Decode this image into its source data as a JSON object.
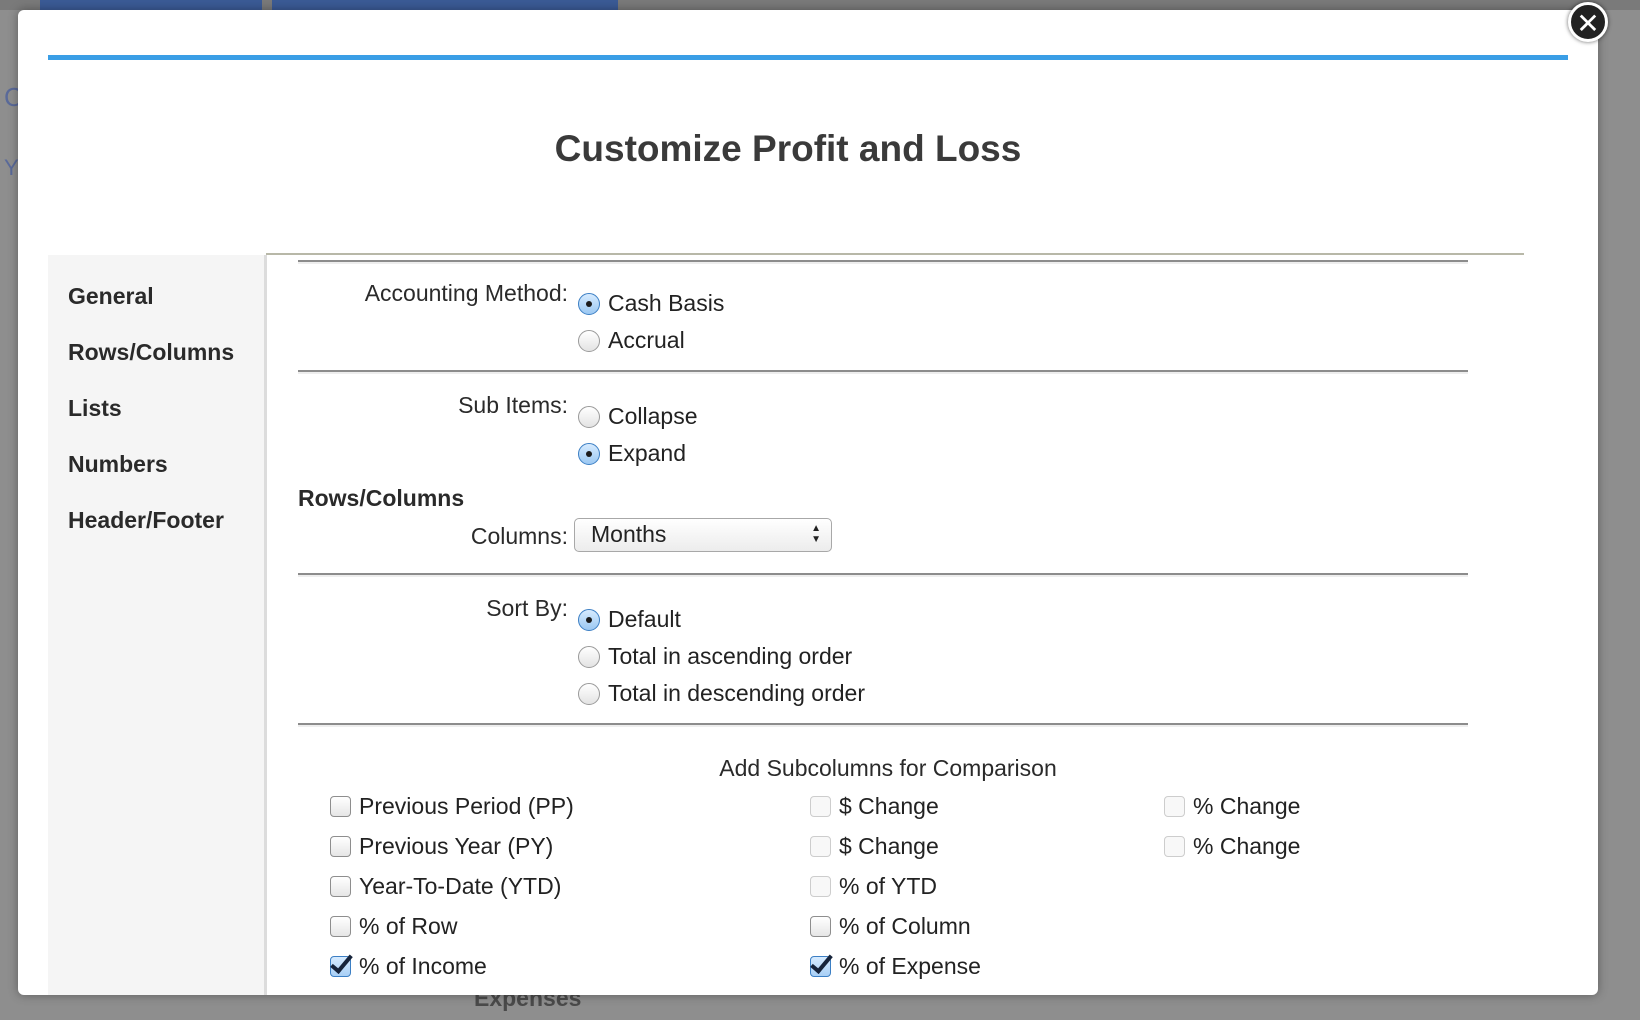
{
  "background": {
    "left_letters": [
      "C",
      "Y"
    ],
    "peek_text": "Expenses"
  },
  "dialog": {
    "title": "Customize Profit and Loss",
    "close_icon": "close-icon"
  },
  "sidebar": {
    "items": [
      {
        "label": "General"
      },
      {
        "label": "Rows/Columns"
      },
      {
        "label": "Lists"
      },
      {
        "label": "Numbers"
      },
      {
        "label": "Header/Footer"
      }
    ]
  },
  "general": {
    "accounting_method_label": "Accounting Method:",
    "accounting_options": [
      {
        "label": "Cash Basis",
        "selected": true
      },
      {
        "label": "Accrual",
        "selected": false
      }
    ],
    "sub_items_label": "Sub Items:",
    "sub_items_options": [
      {
        "label": "Collapse",
        "selected": false
      },
      {
        "label": "Expand",
        "selected": true
      }
    ]
  },
  "rows_columns": {
    "heading": "Rows/Columns",
    "columns_label": "Columns:",
    "columns_value": "Months",
    "sort_by_label": "Sort By:",
    "sort_options": [
      {
        "label": "Default",
        "selected": true
      },
      {
        "label": "Total in ascending order",
        "selected": false
      },
      {
        "label": "Total in descending order",
        "selected": false
      }
    ]
  },
  "comparison": {
    "title": "Add Subcolumns for Comparison",
    "rows": [
      [
        {
          "label": "Previous Period (PP)",
          "checked": false
        },
        {
          "label": "$ Change",
          "checked": false,
          "disabled": true
        },
        {
          "label": "% Change",
          "checked": false,
          "disabled": true
        }
      ],
      [
        {
          "label": "Previous Year (PY)",
          "checked": false
        },
        {
          "label": "$ Change",
          "checked": false,
          "disabled": true
        },
        {
          "label": "% Change",
          "checked": false,
          "disabled": true
        }
      ],
      [
        {
          "label": "Year-To-Date (YTD)",
          "checked": false
        },
        {
          "label": "% of YTD",
          "checked": false,
          "disabled": true
        }
      ],
      [
        {
          "label": "% of Row",
          "checked": false
        },
        {
          "label": "% of Column",
          "checked": false
        }
      ],
      [
        {
          "label": "% of Income",
          "checked": true
        },
        {
          "label": "% of Expense",
          "checked": true
        }
      ]
    ]
  },
  "colors": {
    "accent_blue": "#3a9ee6",
    "backdrop": "#8e8e8e"
  }
}
